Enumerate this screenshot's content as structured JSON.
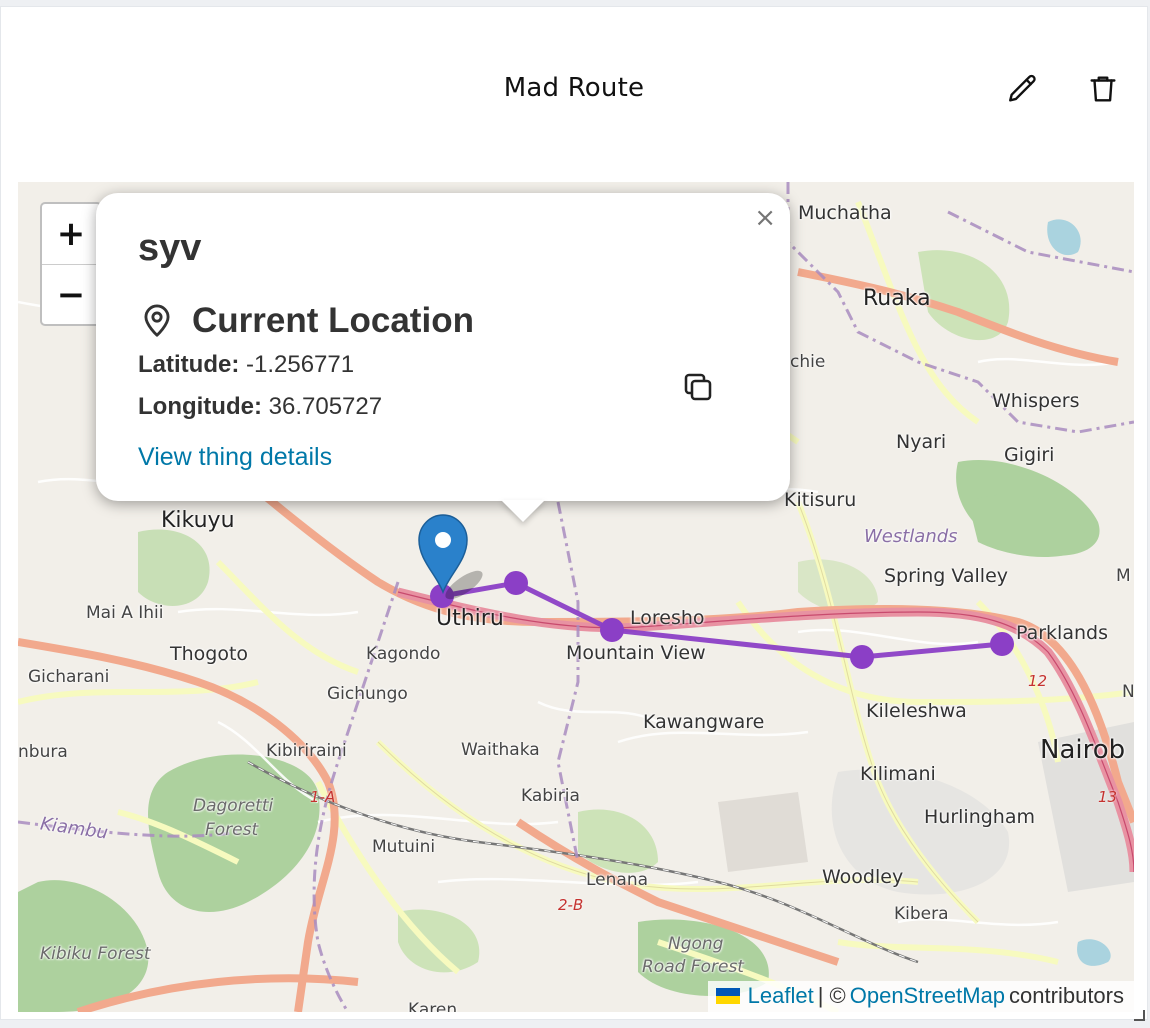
{
  "header": {
    "title": "Mad Route",
    "edit_icon": "pencil-icon",
    "delete_icon": "trash-icon"
  },
  "map": {
    "zoom_in": "+",
    "zoom_out": "−",
    "labels": {
      "muchatha": "Muchatha",
      "ruaka": "Ruaka",
      "chie": "chie",
      "whispers": "Whispers",
      "nyari": "Nyari",
      "gigiri": "Gigiri",
      "kitisuru": "Kitisuru",
      "westlands": "Westlands",
      "spring_valley": "Spring Valley",
      "kikuyu": "Kikuyu",
      "mai_a_ihii": "Mai A Ihii",
      "uthiru": "Uthiru",
      "loresho": "Loresho",
      "mountain_view": "Mountain View",
      "parklands": "Parklands",
      "thogoto": "Thogoto",
      "kagondo": "Kagondo",
      "gicharani": "Gicharani",
      "gichungo": "Gichungo",
      "kawangware": "Kawangware",
      "kileleshwa": "Kileleshwa",
      "nbura": "nbura",
      "kibiriraini": "Kibiriraini",
      "waithaka": "Waithaka",
      "nairobi": "Nairob",
      "kilimani": "Kilimani",
      "dagoretti": "Dagoretti",
      "forest": "Forest",
      "kabiria": "Kabiria",
      "hurlingham": "Hurlingham",
      "kiambu": "Kiambu",
      "mutuini": "Mutuini",
      "lenana": "Lenana",
      "woodley": "Woodley",
      "kibera": "Kibera",
      "kibiku": "Kibiku Forest",
      "ngong": "Ngong",
      "road_forest": "Road Forest",
      "karen": "Karen",
      "m_edge": "M",
      "n_edge": "N",
      "road_12": "12",
      "road_13": "13",
      "road_1a": "1-A",
      "road_2b": "2-B"
    },
    "route_color": "#8b3fc6",
    "marker_icon": "map-pin-icon"
  },
  "popup": {
    "close": "×",
    "title": "syv",
    "location_heading": "Current Location",
    "location_icon": "location-pin-icon",
    "latitude_label": "Latitude:",
    "latitude_value": "-1.256771",
    "longitude_label": "Longitude:",
    "longitude_value": "36.705727",
    "copy_icon": "copy-icon",
    "details_link": "View thing details"
  },
  "attribution": {
    "leaflet": "Leaflet",
    "separator": "| ©",
    "osm": "OpenStreetMap",
    "suffix": "contributors"
  }
}
